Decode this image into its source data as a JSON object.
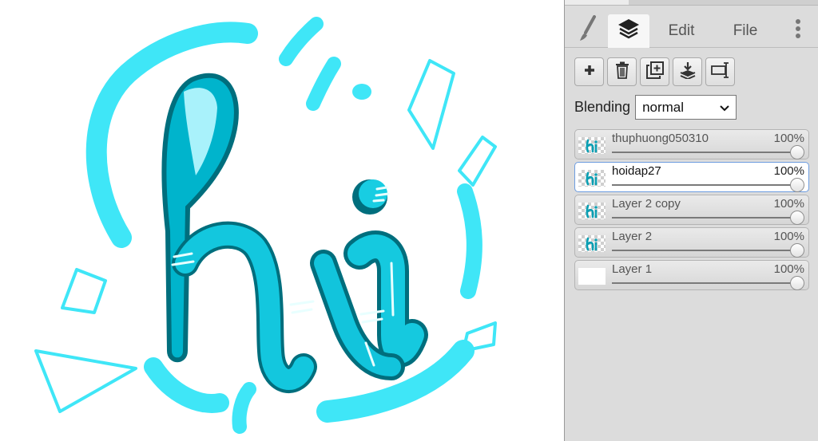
{
  "tabs": {
    "brush_icon": "brush-icon",
    "layers_icon": "layers-icon",
    "edit": "Edit",
    "file": "File",
    "more_icon": "more-vertical-icon"
  },
  "toolbar": {
    "buttons": [
      {
        "name": "add-layer-button",
        "icon": "plus-icon"
      },
      {
        "name": "delete-layer-button",
        "icon": "trash-icon"
      },
      {
        "name": "duplicate-layer-button",
        "icon": "duplicate-icon"
      },
      {
        "name": "merge-down-button",
        "icon": "merge-down-icon"
      },
      {
        "name": "rename-layer-button",
        "icon": "rename-icon"
      }
    ]
  },
  "blending": {
    "label": "Blending",
    "value": "normal"
  },
  "layers": [
    {
      "name": "thuphuong050310",
      "opacity": "100%",
      "opacity_value": 1.0,
      "selected": false,
      "thumb": "checker"
    },
    {
      "name": "hoidap27",
      "opacity": "100%",
      "opacity_value": 1.0,
      "selected": true,
      "thumb": "checker"
    },
    {
      "name": "Layer 2 copy",
      "opacity": "100%",
      "opacity_value": 1.0,
      "selected": false,
      "thumb": "checker"
    },
    {
      "name": "Layer 2",
      "opacity": "100%",
      "opacity_value": 1.0,
      "selected": false,
      "thumb": "checker"
    },
    {
      "name": "Layer 1",
      "opacity": "100%",
      "opacity_value": 1.0,
      "selected": false,
      "thumb": "plain"
    }
  ],
  "colors": {
    "accent_cyan": "#3fe6f7",
    "letter_fill": "#00c3dc",
    "letter_dark": "#007d8c",
    "selection_border": "#6d9de0"
  }
}
